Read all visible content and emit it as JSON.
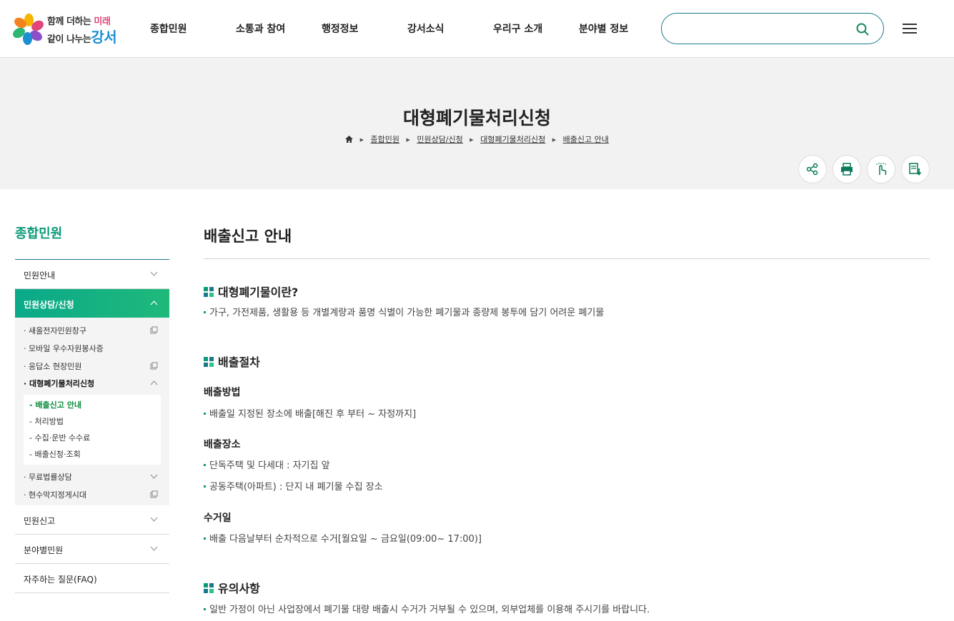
{
  "header": {
    "logo": {
      "line1": "함께 더하는",
      "line1_accent": "미래",
      "line2": "같이 나누는",
      "line2_accent": "강서"
    },
    "nav": [
      "종합민원",
      "소통과 참여",
      "행정정보",
      "강서소식",
      "우리구 소개",
      "분야별 정보"
    ],
    "search": {
      "value": "",
      "placeholder": ""
    },
    "icons": {
      "search": "search-icon",
      "menu": "hamburger-menu-icon"
    }
  },
  "banner": {
    "title": "대형폐기물처리신청",
    "breadcrumb": [
      "종합민원",
      "민원상담/신청",
      "대형폐기물처리신청",
      "배출신고 안내"
    ],
    "tools": [
      "share-icon",
      "print-icon",
      "touch-icon",
      "download-icon"
    ]
  },
  "sidebar": {
    "title": "종합민원",
    "items": [
      {
        "label": "민원안내",
        "state": "collapsed"
      },
      {
        "label": "민원상담/신청",
        "state": "expanded"
      },
      {
        "label": "민원신고",
        "state": "collapsed"
      },
      {
        "label": "분야별민원",
        "state": "collapsed"
      },
      {
        "label": "자주하는 질문(FAQ)",
        "state": "none"
      }
    ],
    "sub_items": [
      {
        "label": "새올전자민원창구",
        "icon": "external-window-icon"
      },
      {
        "label": "모바일 우수자원봉사증",
        "icon": ""
      },
      {
        "label": "응답소 현장민원",
        "icon": "external-window-icon"
      },
      {
        "label": "대형폐기물처리신청",
        "icon": "chevron-up-icon"
      },
      {
        "label": "무료법률상담",
        "icon": "chevron-down-icon"
      },
      {
        "label": "현수막지정게시대",
        "icon": "external-window-icon"
      }
    ],
    "sub_sub_items": [
      "배출신고 안내",
      "처리방법",
      "수집·운반 수수료",
      "배출신청·조회"
    ]
  },
  "content": {
    "title": "배출신고 안내",
    "sections": [
      {
        "heading": "대형폐기물이란?",
        "bullets": [
          "가구, 가전제품, 생활용 등 개별계량과 품명 식별이 가능한 폐기물과 종량제 봉투에 담기 어려운 폐기물"
        ]
      },
      {
        "heading": "배출절차"
      },
      {
        "heading": "유의사항",
        "bullets": [
          "일반 가정이 아닌 사업장에서 폐기물 대량 배출시 수거가 거부될 수 있으며, 외부업체를 이용해 주시기를 바랍니다."
        ]
      }
    ],
    "subsections": [
      {
        "heading": "배출방법",
        "bullets": [
          "배출일 지정된 장소에 배출[해진 후 부터 ~ 자정까지]"
        ]
      },
      {
        "heading": "배출장소",
        "bullets": [
          "단독주택 및 다세대 : 자기집 앞",
          "공동주택(아파트) : 단지 내 폐기물 수집 장소"
        ]
      },
      {
        "heading": "수거일",
        "bullets": [
          "배출 다음날부터 순차적으로 수거[월요일 ~ 금요일(09:00~ 17:00)]"
        ]
      }
    ]
  },
  "colors": {
    "accent_green": "#0a9a78",
    "search_border": "#1a7a8c",
    "active_gradient_start": "#0aa98a",
    "active_gradient_end": "#1fb97a"
  }
}
